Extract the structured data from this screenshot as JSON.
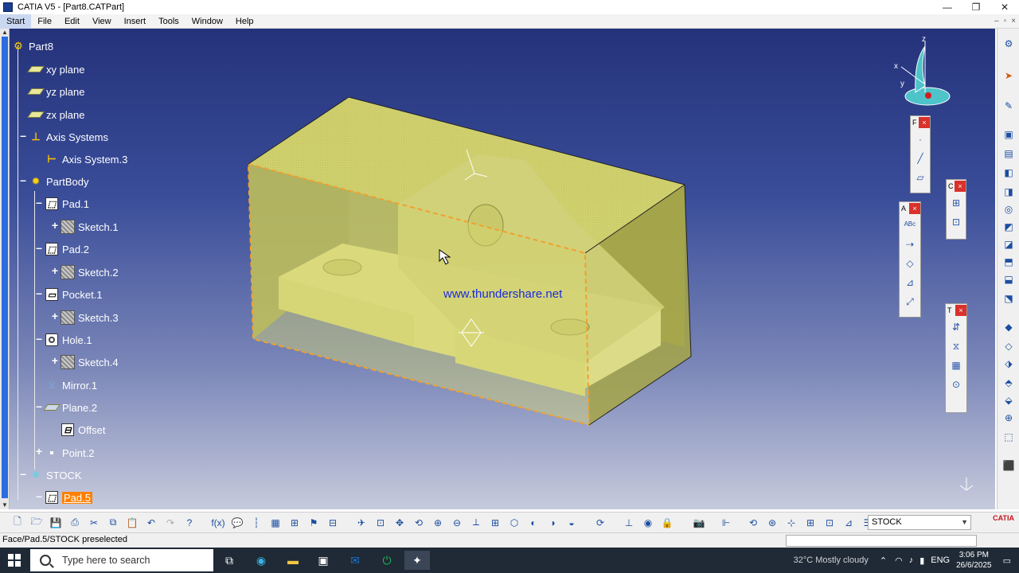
{
  "window": {
    "title": "CATIA V5 - [Part8.CATPart]",
    "controls": [
      "—",
      "❐",
      "✕"
    ]
  },
  "menu": {
    "items": [
      "Start",
      "File",
      "Edit",
      "View",
      "Insert",
      "Tools",
      "Window",
      "Help"
    ]
  },
  "tree": {
    "root": "Part8",
    "nodes": [
      {
        "label": "xy plane",
        "icon": "plane-icon"
      },
      {
        "label": "yz plane",
        "icon": "plane-icon"
      },
      {
        "label": "zx plane",
        "icon": "plane-icon"
      },
      {
        "label": "Axis Systems",
        "icon": "axis-systems-icon"
      },
      {
        "label": "Axis System.3",
        "icon": "axis-system-icon"
      },
      {
        "label": "PartBody",
        "icon": "part-body-icon"
      },
      {
        "label": "Pad.1",
        "icon": "pad-icon"
      },
      {
        "label": "Sketch.1",
        "icon": "sketch-icon"
      },
      {
        "label": "Pad.2",
        "icon": "pad-icon"
      },
      {
        "label": "Sketch.2",
        "icon": "sketch-icon"
      },
      {
        "label": "Pocket.1",
        "icon": "pocket-icon"
      },
      {
        "label": "Sketch.3",
        "icon": "sketch-icon"
      },
      {
        "label": "Hole.1",
        "icon": "hole-icon"
      },
      {
        "label": "Sketch.4",
        "icon": "sketch-icon"
      },
      {
        "label": "Mirror.1",
        "icon": "mirror-icon"
      },
      {
        "label": "Plane.2",
        "icon": "plane-icon"
      },
      {
        "label": "Offset",
        "icon": "offset-icon"
      },
      {
        "label": "Point.2",
        "icon": "point-icon"
      },
      {
        "label": "STOCK",
        "icon": "stock-body-icon"
      },
      {
        "label": "Pad.5",
        "icon": "pad-icon",
        "highlighted": true
      }
    ]
  },
  "viewport": {
    "watermark": "www.thundershare.net",
    "compass_labels": {
      "x": "x",
      "y": "y",
      "z": "z"
    }
  },
  "floating_toolbars": {
    "f_title": "F",
    "a_title": "A",
    "c_title": "C",
    "t_title": "T"
  },
  "bottom_toolbar": {
    "stock_select": "STOCK",
    "logo": "CATIA"
  },
  "status": {
    "text": "Face/Pad.5/STOCK preselected"
  },
  "taskbar": {
    "search_placeholder": "Type here to search",
    "weather": "32°C  Mostly cloudy",
    "language": "ENG",
    "time": "3:06 PM",
    "date": "26/6/2025"
  },
  "colors": {
    "highlight": "#ff7f00",
    "model_fill": "#d4d46a",
    "viewport_top": "#24327a",
    "viewport_bottom": "#c6cadc"
  }
}
